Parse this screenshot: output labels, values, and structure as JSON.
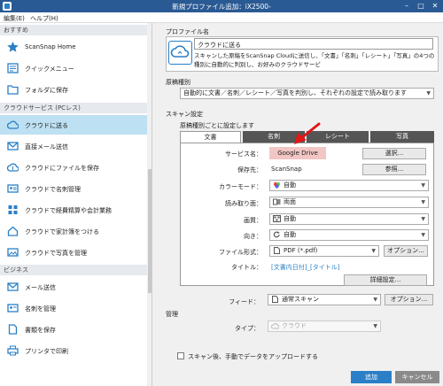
{
  "window": {
    "title": "新規プロファイル追加：iX2500-",
    "minimize": "–",
    "maximize": "□",
    "close": "✕"
  },
  "menu": {
    "edit": "編集(E)",
    "help": "ヘルプ(H)"
  },
  "sidebar": {
    "sections": [
      {
        "header": "おすすめ",
        "items": [
          "ScanSnap Home",
          "クイックメニュー",
          "フォルダに保存"
        ]
      },
      {
        "header": "クラウドサービス (PCレス)",
        "items": [
          "クラウドに送る",
          "直接メール送信",
          "クラウドにファイルを保存",
          "クラウドで名刺管理",
          "クラウドで経費精算や会計業務",
          "クラウドで家計簿をつける",
          "クラウドで写真を管理"
        ]
      },
      {
        "header": "ビジネス",
        "items": [
          "メール送信",
          "名刺を管理",
          "書類を保存",
          "プリンタで印刷"
        ]
      }
    ],
    "selected": "クラウドに送る"
  },
  "profile": {
    "section_label": "プロファイル名",
    "name": "クラウドに送る",
    "description": "スキャンした原稿をScanSnap Cloudに送信し、「文書」「名刺」「レシート」「写真」の4つの種別に自動的に判別し、お好みのクラウドサービ"
  },
  "doc_type": {
    "section_label": "原稿種別",
    "value": "自動的に文書／名刺／レシート／写真を判別し、それぞれの設定で読み取ります"
  },
  "scan_settings": {
    "section_label": "スキャン設定",
    "per_type_label": "原稿種別ごとに設定します",
    "tabs": [
      "文書",
      "名刺",
      "レシート",
      "写真"
    ],
    "active_tab": "文書",
    "service_label": "サービス名：",
    "service_value": "Google Drive",
    "select_button": "選択...",
    "save_to_label": "保存先：",
    "save_to_value": "ScanSnap",
    "browse_button": "参照...",
    "color_mode_label": "カラーモード：",
    "color_mode_value": "自動",
    "sides_label": "読み取り面：",
    "sides_value": "両面",
    "quality_label": "画質：",
    "quality_value": "自動",
    "orientation_label": "向き：",
    "orientation_value": "自動",
    "format_label": "ファイル形式：",
    "format_value": "PDF (*.pdf)",
    "options_button": "オプション...",
    "title_label": "タイトル：",
    "title_value": "[文書内日付]_[タイトル]",
    "detail_button": "詳細設定...",
    "feed_label": "フィード：",
    "feed_value": "通常スキャン",
    "feed_options_button": "オプション..."
  },
  "management": {
    "section_label": "管理",
    "type_label": "タイプ：",
    "type_value": "クラウド"
  },
  "upload_checkbox_label": "スキャン後、手動でデータをアップロードする",
  "footer": {
    "add_button": "追加",
    "cancel_button": "キャンセル"
  },
  "colors": {
    "accent": "#2a7fc6",
    "selected": "#bde0f2",
    "highlight": "#f3c6c6",
    "annotation_arrow": "#e01818"
  }
}
